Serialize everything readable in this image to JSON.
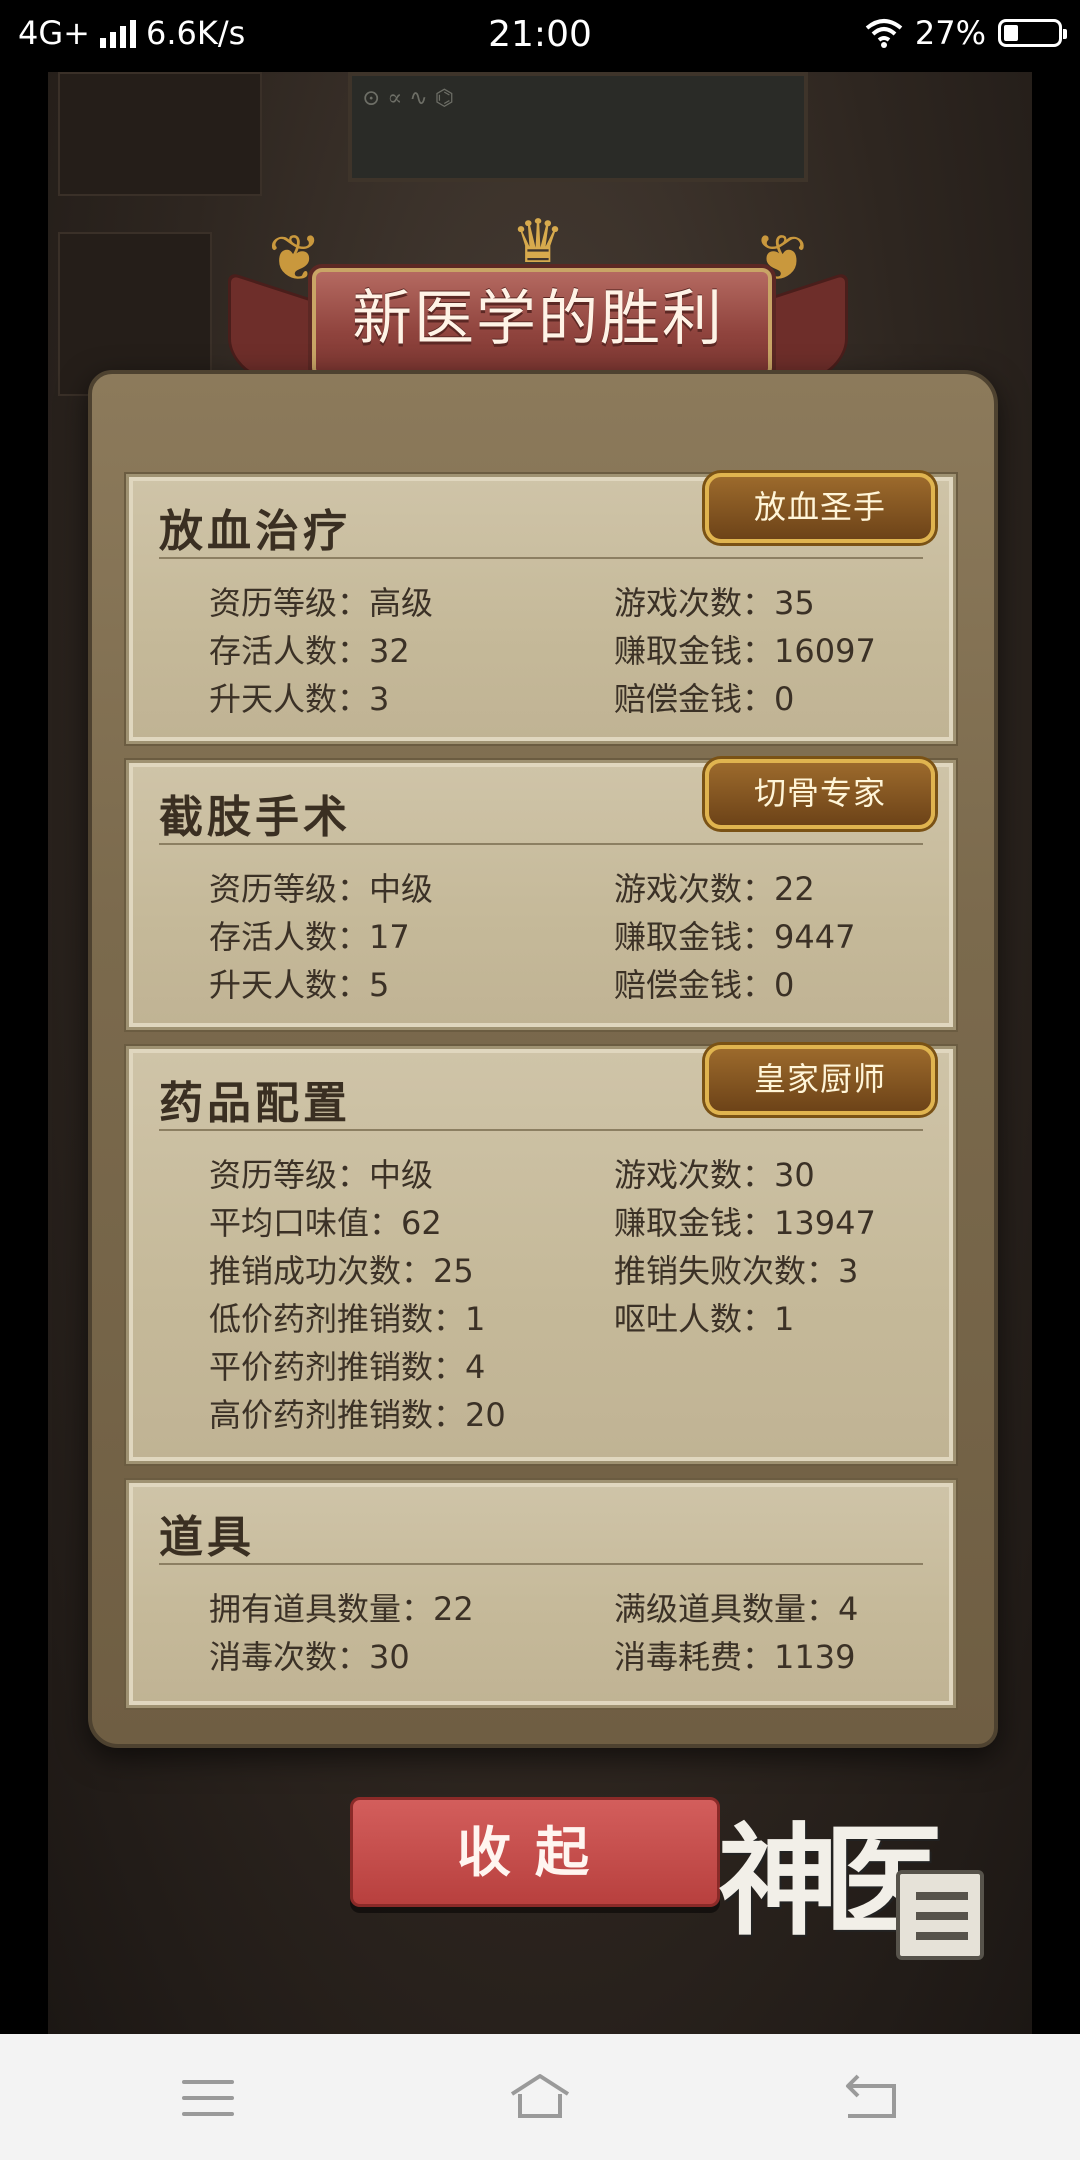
{
  "status_bar": {
    "network": "4G+",
    "speed": "6.6K/s",
    "time": "21:00",
    "battery_percent": "27%",
    "battery_level": 0.27
  },
  "banner": {
    "title": "新医学的胜利"
  },
  "sections": [
    {
      "heading": "放血治疗",
      "badge": "放血圣手",
      "rows": [
        [
          "资历等级：高级",
          "游戏次数：35"
        ],
        [
          "存活人数：32",
          "赚取金钱：16097"
        ],
        [
          "升天人数：3",
          "赔偿金钱：0"
        ]
      ]
    },
    {
      "heading": "截肢手术",
      "badge": "切骨专家",
      "rows": [
        [
          "资历等级：中级",
          "游戏次数：22"
        ],
        [
          "存活人数：17",
          "赚取金钱：9447"
        ],
        [
          "升天人数：5",
          "赔偿金钱：0"
        ]
      ]
    },
    {
      "heading": "药品配置",
      "badge": "皇家厨师",
      "rows": [
        [
          "资历等级：中级",
          "游戏次数：30"
        ],
        [
          "平均口味值：62",
          "赚取金钱：13947"
        ],
        [
          "推销成功次数：25",
          "推销失败次数：3"
        ],
        [
          "低价药剂推销数：1",
          "呕吐人数：1"
        ],
        [
          "平价药剂推销数：4",
          ""
        ],
        [
          "高价药剂推销数：20",
          ""
        ]
      ]
    },
    {
      "heading": "道具",
      "badge": "",
      "rows": [
        [
          "拥有道具数量：22",
          "满级道具数量：4"
        ],
        [
          "消毒次数：30",
          "消毒耗费：1139"
        ]
      ]
    }
  ],
  "actions": {
    "collapse_label": "收起"
  },
  "logo_text": "神医"
}
